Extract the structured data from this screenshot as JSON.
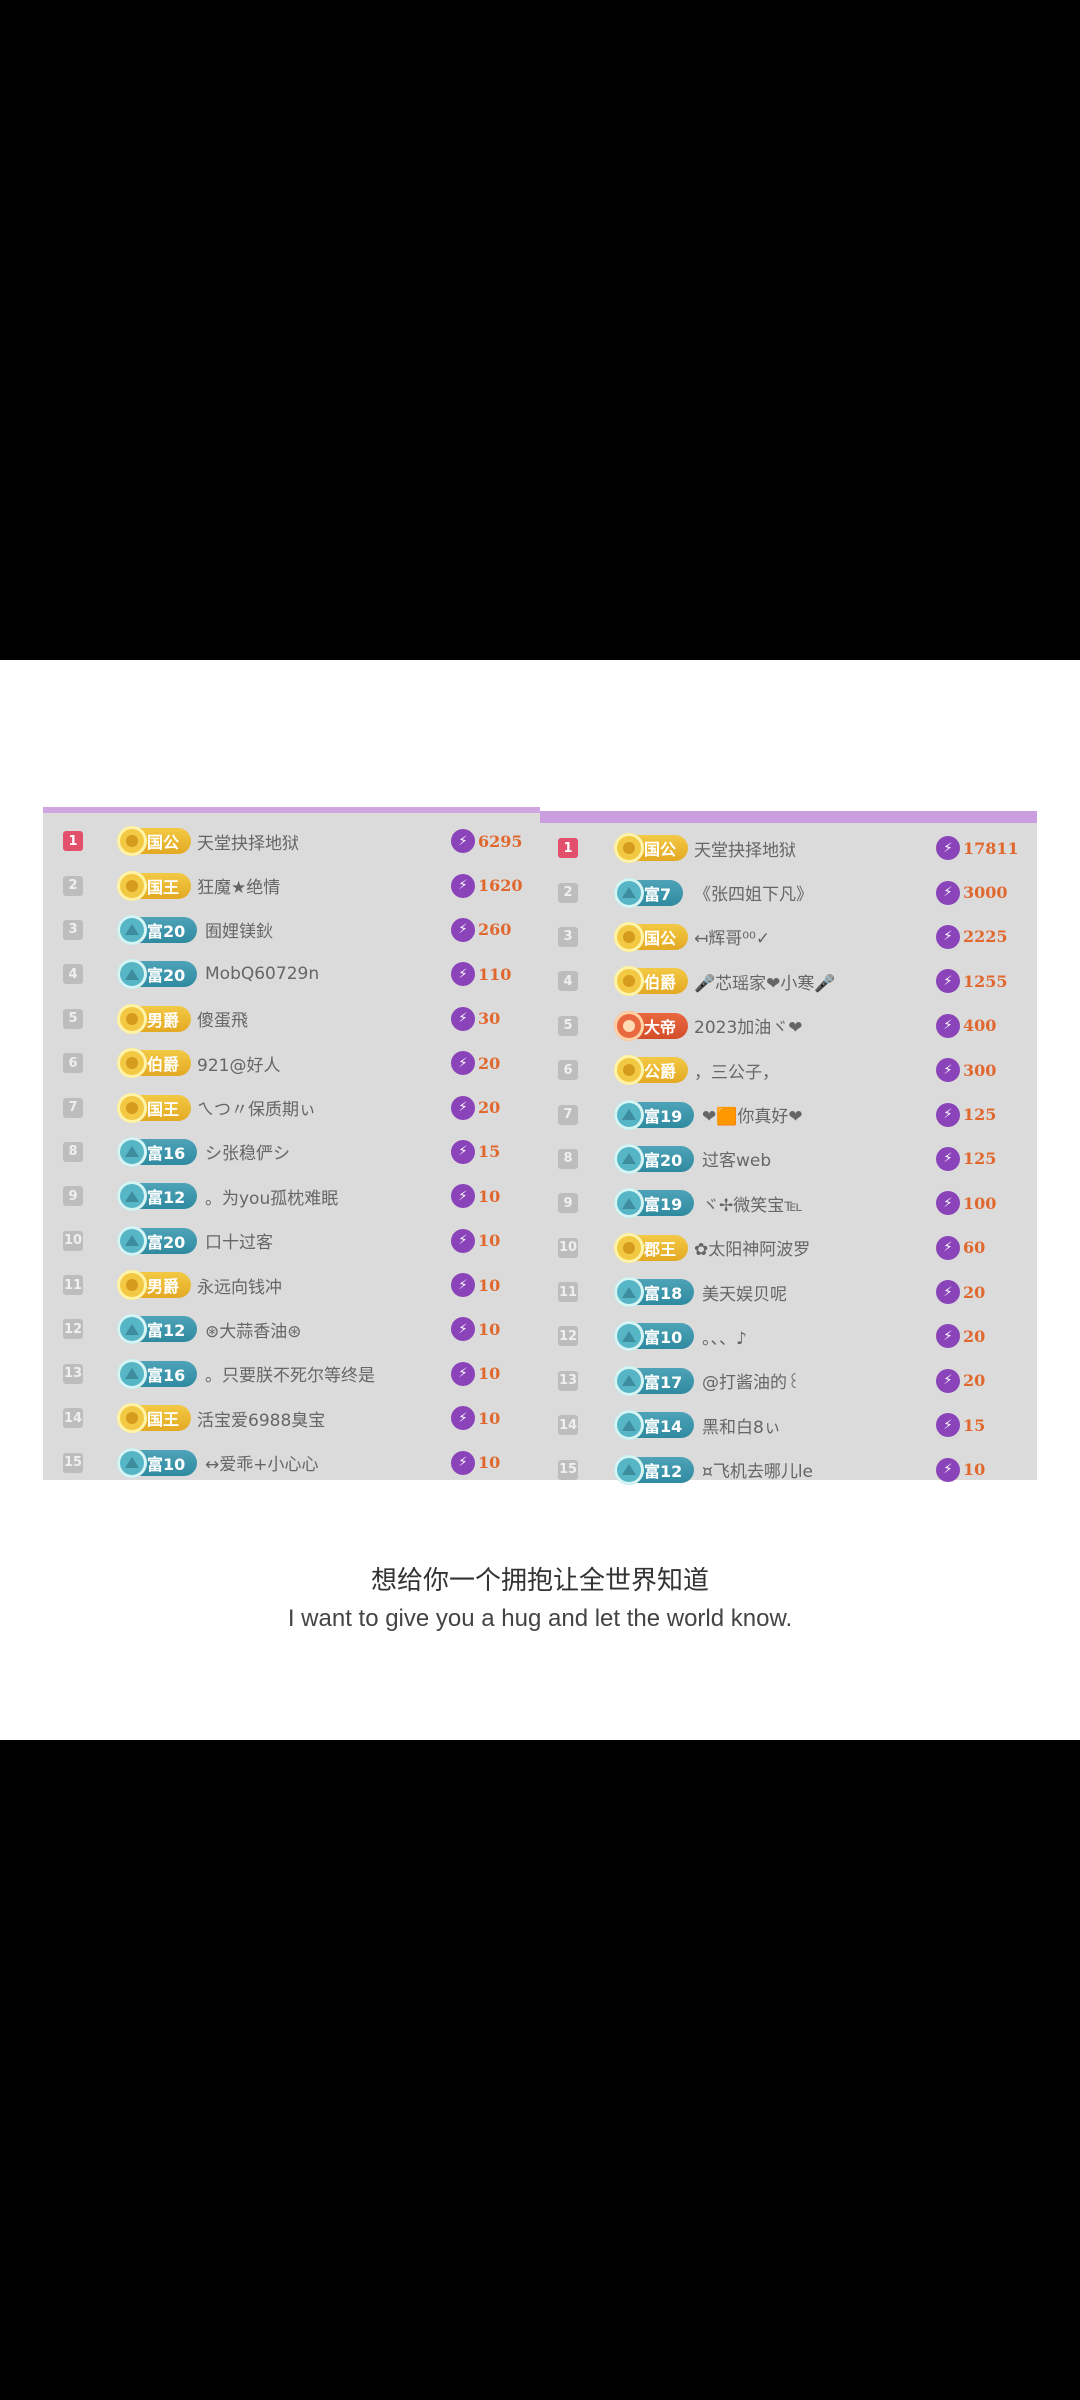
{
  "left_board": {
    "rows": [
      {
        "rank": "1",
        "badge": "国公",
        "badge_style": "gold",
        "name": "天堂抉择地狱",
        "score": "6295"
      },
      {
        "rank": "2",
        "badge": "国王",
        "badge_style": "gold",
        "name": "狂魔★绝情",
        "score": "1620"
      },
      {
        "rank": "3",
        "badge": "富20",
        "badge_style": "teal",
        "name": "囿娌镁鈥",
        "score": "260"
      },
      {
        "rank": "4",
        "badge": "富20",
        "badge_style": "teal",
        "name": "MobQ60729n",
        "score": "110"
      },
      {
        "rank": "5",
        "badge": "男爵",
        "badge_style": "gold",
        "name": "傻蛋飛",
        "score": "30"
      },
      {
        "rank": "6",
        "badge": "伯爵",
        "badge_style": "gold",
        "name": "921@好人",
        "score": "20"
      },
      {
        "rank": "7",
        "badge": "国王",
        "badge_style": "gold",
        "name": "ㄟつ〃保质期ぃ",
        "score": "20"
      },
      {
        "rank": "8",
        "badge": "富16",
        "badge_style": "teal",
        "name": "シ张稳俨シ",
        "score": "15"
      },
      {
        "rank": "9",
        "badge": "富12",
        "badge_style": "teal",
        "name": "。为you孤枕难眠",
        "score": "10"
      },
      {
        "rank": "10",
        "badge": "富20",
        "badge_style": "teal",
        "name": "口十过客",
        "score": "10"
      },
      {
        "rank": "11",
        "badge": "男爵",
        "badge_style": "gold",
        "name": "永远向钱冲",
        "score": "10"
      },
      {
        "rank": "12",
        "badge": "富12",
        "badge_style": "teal",
        "name": "⊛大蒜香油⊛",
        "score": "10"
      },
      {
        "rank": "13",
        "badge": "富16",
        "badge_style": "teal",
        "name": "。只要朕不死尔等终是",
        "score": "10"
      },
      {
        "rank": "14",
        "badge": "国王",
        "badge_style": "gold",
        "name": "活宝爱6988臭宝",
        "score": "10"
      },
      {
        "rank": "15",
        "badge": "富10",
        "badge_style": "teal",
        "name": "↔爱乖+小心心",
        "score": "10"
      }
    ]
  },
  "right_board": {
    "rows": [
      {
        "rank": "1",
        "badge": "国公",
        "badge_style": "gold",
        "name": "天堂抉择地狱",
        "score": "17811"
      },
      {
        "rank": "2",
        "badge": "富7",
        "badge_style": "teal",
        "name": "《张四姐下凡》",
        "score": "3000"
      },
      {
        "rank": "3",
        "badge": "国公",
        "badge_style": "gold",
        "name": "↤辉哥⁰⁰✓",
        "score": "2225"
      },
      {
        "rank": "4",
        "badge": "伯爵",
        "badge_style": "gold",
        "name": "🎤芯瑶家❤小寒🎤",
        "score": "1255"
      },
      {
        "rank": "5",
        "badge": "大帝",
        "badge_style": "red",
        "name": "2023加油ヾ❤",
        "score": "400"
      },
      {
        "rank": "6",
        "badge": "公爵",
        "badge_style": "gold",
        "name": "，三公子，",
        "score": "300"
      },
      {
        "rank": "7",
        "badge": "富19",
        "badge_style": "teal",
        "name": "❤🟧你真好❤",
        "score": "125"
      },
      {
        "rank": "8",
        "badge": "富20",
        "badge_style": "teal",
        "name": "过客web",
        "score": "125"
      },
      {
        "rank": "9",
        "badge": "富19",
        "badge_style": "teal",
        "name": "ヾ✢微笑宝℡",
        "score": "100"
      },
      {
        "rank": "10",
        "badge": "郡王",
        "badge_style": "gold",
        "name": "✿太阳神阿波罗",
        "score": "60"
      },
      {
        "rank": "11",
        "badge": "富18",
        "badge_style": "teal",
        "name": "美天娱贝呢",
        "score": "20"
      },
      {
        "rank": "12",
        "badge": "富10",
        "badge_style": "teal",
        "name": "。、、♪",
        "score": "20"
      },
      {
        "rank": "13",
        "badge": "富17",
        "badge_style": "teal",
        "name": "@打酱油的꒰",
        "score": "20"
      },
      {
        "rank": "14",
        "badge": "富14",
        "badge_style": "teal",
        "name": "黑和白8ぃ",
        "score": "15"
      },
      {
        "rank": "15",
        "badge": "富12",
        "badge_style": "teal",
        "name": "¤飞机去哪儿le",
        "score": "10"
      }
    ]
  },
  "subtitle": {
    "zh": "想给你一个拥抱让全世界知道",
    "en": "I want to give you a hug and let the world know."
  },
  "icons": {
    "score_icon": "lightning-bolt-icon"
  },
  "colors": {
    "accent_purple": "#8a43b8",
    "score_orange": "#e0682f",
    "rank1_red": "#e2506b"
  }
}
